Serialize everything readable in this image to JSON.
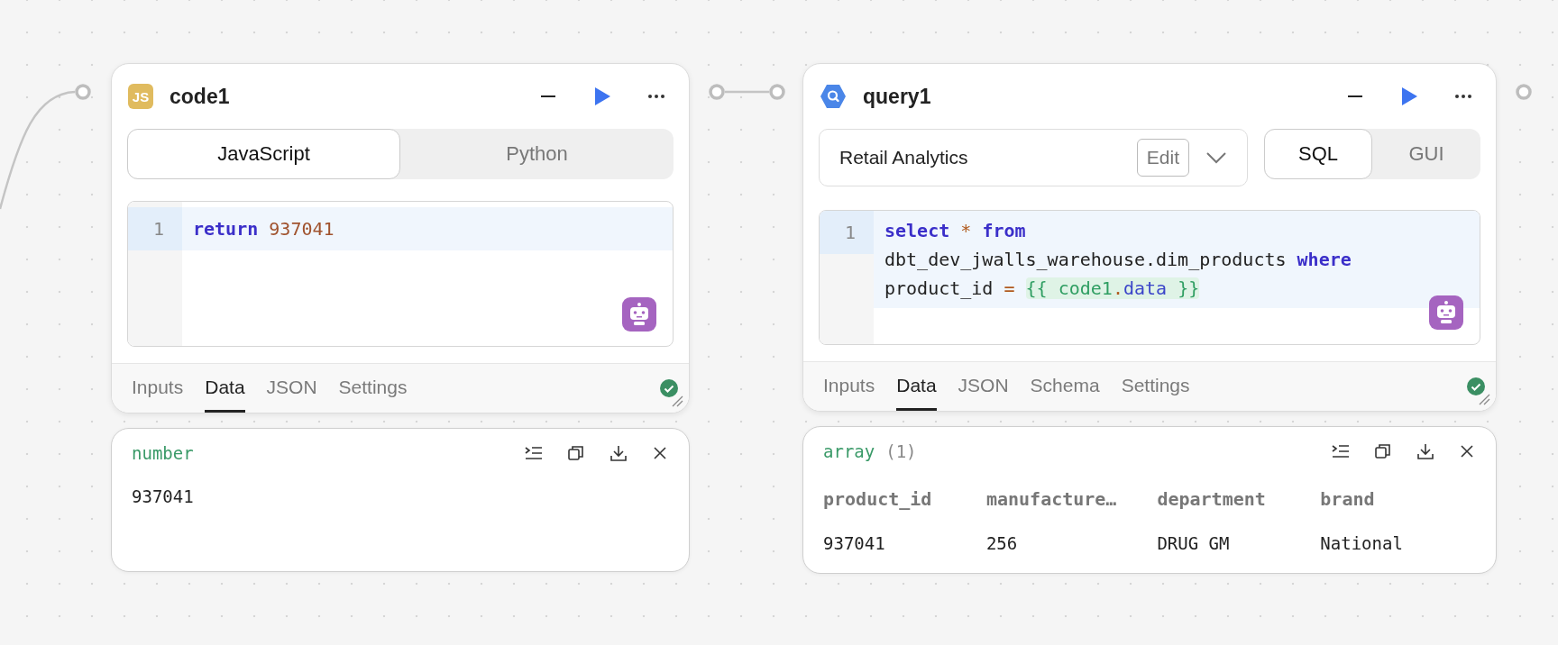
{
  "nodes": [
    {
      "kind": "code",
      "title": "code1",
      "badge": "JS",
      "languages": [
        {
          "label": "JavaScript",
          "selected": true
        },
        {
          "label": "Python",
          "selected": false
        }
      ],
      "editor": {
        "lines": [
          {
            "number": "1",
            "active": true,
            "tokens": [
              {
                "kind": "keyword",
                "text": "return "
              },
              {
                "kind": "number",
                "text": "937041"
              }
            ]
          }
        ]
      },
      "tabs": [
        {
          "label": "Inputs",
          "selected": false
        },
        {
          "label": "Data",
          "selected": true
        },
        {
          "label": "JSON",
          "selected": false
        },
        {
          "label": "Settings",
          "selected": false
        }
      ],
      "succeeded": true,
      "output": {
        "type": "number",
        "value": "937041"
      }
    },
    {
      "kind": "query",
      "title": "query1",
      "resource": {
        "name": "Retail Analytics",
        "edit": "Edit"
      },
      "modes": [
        {
          "label": "SQL",
          "selected": true
        },
        {
          "label": "GUI",
          "selected": false
        }
      ],
      "editor": {
        "lines": [
          {
            "number": "1",
            "active": true,
            "tokens": [
              {
                "kind": "keyword",
                "text": "select "
              },
              {
                "kind": "operator",
                "text": "* "
              },
              {
                "kind": "keyword",
                "text": "from"
              },
              {
                "kind": "plain",
                "text": " dbt_dev_jwalls_warehouse.dim_products "
              },
              {
                "kind": "keyword",
                "text": "where"
              },
              {
                "kind": "plain",
                "text": " product_id "
              },
              {
                "kind": "operator",
                "text": "= "
              },
              {
                "kind": "template",
                "parts": [
                  {
                    "kind": "brace",
                    "text": "{{ code1"
                  },
                  {
                    "kind": "operator",
                    "text": "."
                  },
                  {
                    "kind": "keyword",
                    "text": "data"
                  },
                  {
                    "kind": "brace",
                    "text": " }}"
                  }
                ]
              }
            ]
          }
        ]
      },
      "tabs": [
        {
          "label": "Inputs",
          "selected": false
        },
        {
          "label": "Data",
          "selected": true
        },
        {
          "label": "JSON",
          "selected": false
        },
        {
          "label": "Schema",
          "selected": false
        },
        {
          "label": "Settings",
          "selected": false
        }
      ],
      "succeeded": true,
      "output": {
        "type": "array",
        "count": "(1)",
        "columns": [
          "product_id",
          "manufacture…",
          "department",
          "brand"
        ],
        "rows": [
          [
            "937041",
            "256",
            "DRUG GM",
            "National"
          ]
        ]
      }
    }
  ]
}
